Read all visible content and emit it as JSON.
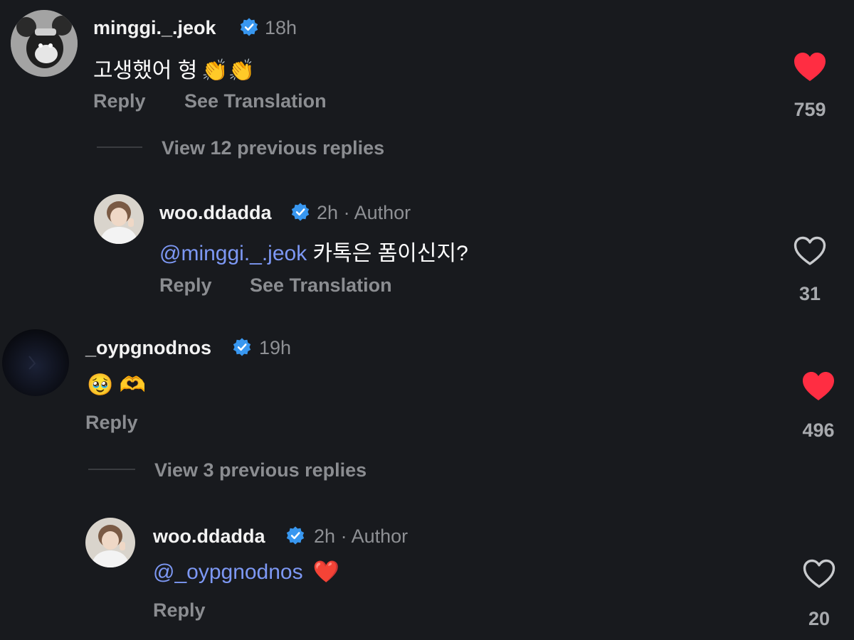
{
  "colors": {
    "background": "#181a1e",
    "mention": "#7d98f4",
    "verified": "#3897f0",
    "liked_heart": "#ff2d42",
    "muted": "#8b8d91"
  },
  "comments": [
    {
      "username": "minggi._.jeok",
      "verified": true,
      "time": "18h",
      "text": "고생했어 형",
      "emoji": "👏👏",
      "actions": {
        "reply": "Reply",
        "translate": "See Translation"
      },
      "liked": true,
      "likes": "759",
      "view_replies": "View 12 previous replies",
      "reply": {
        "username": "woo.ddadda",
        "verified": true,
        "time": "2h",
        "separator": "·",
        "role": "Author",
        "mention": "@minggi._.jeok",
        "text": " 카톡은 폼이신지?",
        "actions": {
          "reply": "Reply",
          "translate": "See Translation"
        },
        "liked": false,
        "likes": "31"
      }
    },
    {
      "username": "_oypgnodnos",
      "verified": true,
      "time": "19h",
      "text": "",
      "emoji": "🥹 🫶",
      "actions": {
        "reply": "Reply"
      },
      "liked": true,
      "likes": "496",
      "view_replies": "View 3 previous replies",
      "reply": {
        "username": "woo.ddadda",
        "verified": true,
        "time": "2h",
        "separator": "·",
        "role": "Author",
        "mention": "@_oypgnodnos",
        "text": "",
        "emoji": "❤️",
        "actions": {
          "reply": "Reply"
        },
        "liked": false,
        "likes": "20"
      }
    }
  ]
}
